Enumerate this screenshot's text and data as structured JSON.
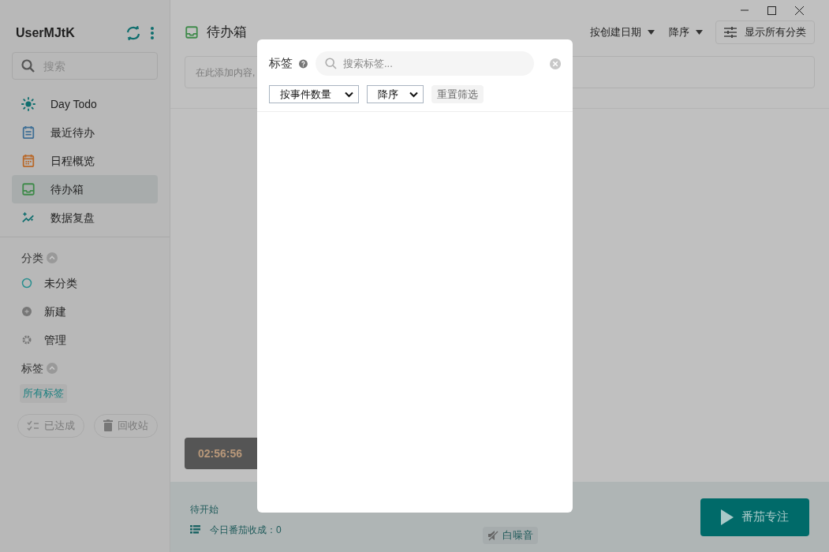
{
  "sidebar": {
    "user": "UserMJtK",
    "search": {
      "placeholder": "搜索"
    },
    "nav": [
      {
        "label": "Day Todo",
        "selected": false
      },
      {
        "label": "最近待办",
        "selected": false
      },
      {
        "label": "日程概览",
        "selected": false
      },
      {
        "label": "待办箱",
        "selected": true
      },
      {
        "label": "数据复盘",
        "selected": false
      }
    ],
    "categories": {
      "title": "分类",
      "expanded": true,
      "items": [
        {
          "label": "未分类"
        },
        {
          "label": "新建"
        },
        {
          "label": "管理"
        }
      ]
    },
    "tags": {
      "title": "标签",
      "expanded": true,
      "items": [
        {
          "label": "所有标签",
          "selected": true
        }
      ]
    },
    "footer_buttons": [
      {
        "label": "已达成"
      },
      {
        "label": "回收站"
      }
    ]
  },
  "main": {
    "title": "待办箱",
    "sort": "按创建日期",
    "order": "降序",
    "show_all": "显示所有分类",
    "input": {
      "placeholder": "在此添加内容,"
    },
    "clock": "02:56:56"
  },
  "bottom_bar": {
    "status": "待开始",
    "today": "今日番茄收成：0",
    "white_noise": "白噪音",
    "start": "番茄专注"
  },
  "tag_popup": {
    "title": "标签",
    "search": {
      "placeholder": "搜索标签..."
    },
    "sort": "按事件数量",
    "order": "降序",
    "reset": "重置筛选"
  }
}
